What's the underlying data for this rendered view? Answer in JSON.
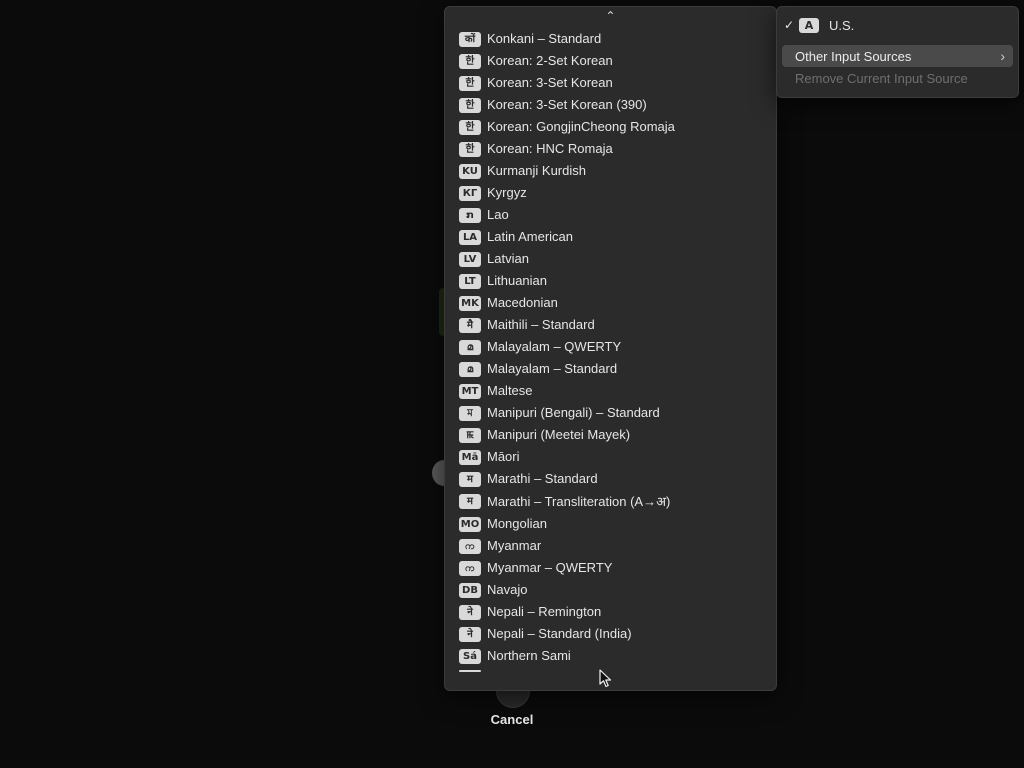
{
  "submenu": {
    "scroll_up_glyph": "⌃",
    "items": [
      {
        "badge": "कों",
        "label": "Konkani – Standard"
      },
      {
        "badge": "한",
        "label": "Korean: 2-Set Korean"
      },
      {
        "badge": "한",
        "label": "Korean: 3-Set Korean"
      },
      {
        "badge": "한",
        "label": "Korean: 3-Set Korean (390)"
      },
      {
        "badge": "한",
        "label": "Korean: GongjinCheong Romaja"
      },
      {
        "badge": "한",
        "label": "Korean: HNC Romaja"
      },
      {
        "badge": "KU",
        "label": "Kurmanji Kurdish"
      },
      {
        "badge": "КГ",
        "label": "Kyrgyz"
      },
      {
        "badge": "ກ",
        "label": "Lao"
      },
      {
        "badge": "LA",
        "label": "Latin American"
      },
      {
        "badge": "LV",
        "label": "Latvian"
      },
      {
        "badge": "LT",
        "label": "Lithuanian"
      },
      {
        "badge": "MK",
        "label": "Macedonian"
      },
      {
        "badge": "मै",
        "label": "Maithili – Standard"
      },
      {
        "badge": "മ",
        "label": "Malayalam – QWERTY"
      },
      {
        "badge": "മ",
        "label": "Malayalam – Standard"
      },
      {
        "badge": "MT",
        "label": "Maltese"
      },
      {
        "badge": "ম",
        "label": "Manipuri (Bengali) – Standard"
      },
      {
        "badge": "ꯃ",
        "label": "Manipuri (Meetei Mayek)"
      },
      {
        "badge": "Mā",
        "label": "Māori"
      },
      {
        "badge": "म",
        "label": "Marathi – Standard"
      },
      {
        "badge": "म",
        "label": "Marathi – Transliteration (A→अ)"
      },
      {
        "badge": "MO",
        "label": "Mongolian"
      },
      {
        "badge": "က",
        "label": "Myanmar"
      },
      {
        "badge": "က",
        "label": "Myanmar – QWERTY"
      },
      {
        "badge": "DB",
        "label": "Navajo"
      },
      {
        "badge": "ने",
        "label": "Nepali – Remington"
      },
      {
        "badge": "ने",
        "label": "Nepali – Standard (India)"
      },
      {
        "badge": "Sá",
        "label": "Northern Sami"
      }
    ]
  },
  "input_menu": {
    "check": "✓",
    "current_badge": "A",
    "current_label": "U.S.",
    "other_sources_label": "Other Input Sources",
    "chevron": "›",
    "remove_label": "Remove Current Input Source"
  },
  "cancel_label": "Cancel",
  "colors": {
    "menu_bg": "#2b2b2b",
    "highlight": "#4a4a4a",
    "badge_bg": "#d9d9d9",
    "disabled_text": "#6f6f6f"
  }
}
